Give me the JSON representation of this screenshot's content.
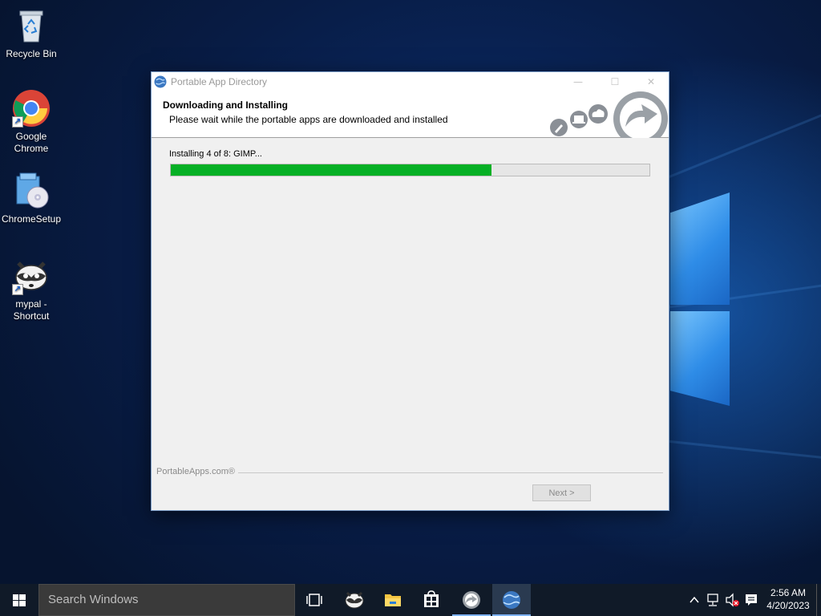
{
  "desktop": {
    "icons": [
      {
        "label": "Recycle Bin"
      },
      {
        "label": "Google Chrome"
      },
      {
        "label": "ChromeSetup"
      },
      {
        "label": "mypal - Shortcut"
      }
    ]
  },
  "window": {
    "title": "Portable App Directory",
    "header_title": "Downloading and Installing",
    "header_subtitle": "Please wait while the portable apps are downloaded and installed",
    "status_text": "Installing 4 of 8: GIMP...",
    "progress_fraction": 0.67,
    "brand_label": "PortableApps.com®",
    "next_label": "Next >",
    "progress_color": "#06b025"
  },
  "taskbar": {
    "search_placeholder": "Search Windows",
    "time": "2:56 AM",
    "date": "4/20/2023"
  }
}
